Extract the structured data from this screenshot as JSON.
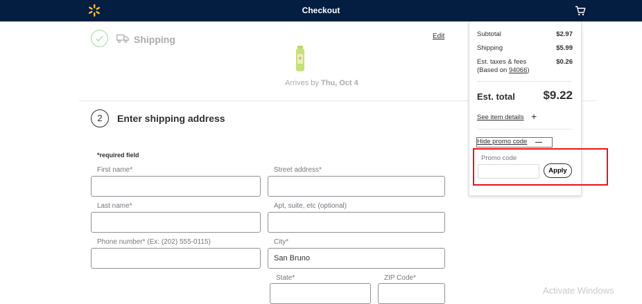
{
  "header": {
    "title": "Checkout",
    "logo_icon": "walmart-spark-icon",
    "cart_icon": "cart-icon",
    "bg_color": "#041e42"
  },
  "shipping": {
    "label": "Shipping",
    "edit_label": "Edit",
    "arrives_prefix": "Arrives by",
    "arrives_date": "Thu, Oct 4"
  },
  "address": {
    "step_number": "2",
    "title": "Enter shipping address",
    "required_note": "*required field",
    "fields": {
      "first_name": {
        "label": "First name*",
        "value": ""
      },
      "street": {
        "label": "Street address*",
        "value": ""
      },
      "last_name": {
        "label": "Last name*",
        "value": ""
      },
      "apt": {
        "label": "Apt, suite, etc (optional)",
        "value": ""
      },
      "phone": {
        "label": "Phone number*  (Ex: (202) 555-0115)",
        "value": ""
      },
      "city": {
        "label": "City*",
        "value": "San Bruno"
      },
      "state": {
        "label": "State*",
        "value": ""
      },
      "zip": {
        "label": "ZIP Code*",
        "value": ""
      }
    }
  },
  "summary": {
    "subtotal_label": "Subtotal",
    "subtotal_value": "$2.97",
    "shipping_label": "Shipping",
    "shipping_value": "$5.99",
    "taxes_label": "Est. taxes & fees",
    "taxes_based": "(Based on ",
    "taxes_zip": "94066",
    "taxes_close": ")",
    "taxes_value": "$0.26",
    "total_label": "Est. total",
    "total_value": "$9.22",
    "item_details_label": "See item details",
    "hide_promo_label": "Hide promo code",
    "promo_label": "Promo code",
    "promo_placeholder": "",
    "apply_label": "Apply"
  },
  "overlay": {
    "watermark": "Activate Windows",
    "highlight_color": "#e81416"
  }
}
